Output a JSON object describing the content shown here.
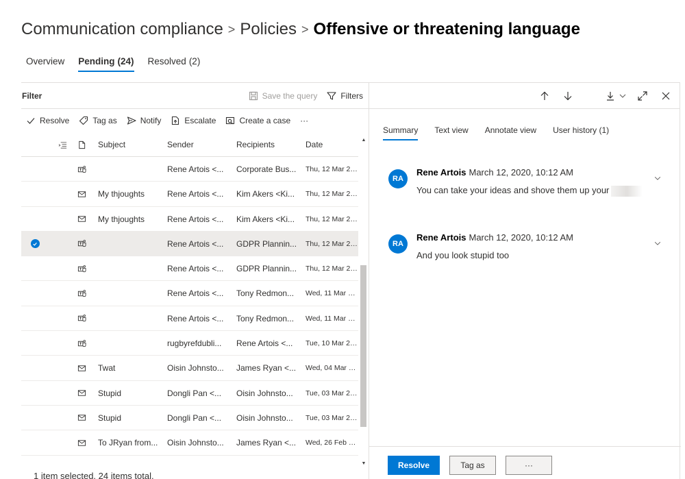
{
  "breadcrumb": {
    "items": [
      "Communication compliance",
      "Policies"
    ],
    "separator": ">",
    "current": "Offensive or threatening language"
  },
  "tabs": [
    {
      "label": "Overview",
      "count": ""
    },
    {
      "label": "Pending",
      "count": "(24)"
    },
    {
      "label": "Resolved",
      "count": "(2)"
    }
  ],
  "filter": {
    "title": "Filter",
    "save_query": "Save the query",
    "filters": "Filters"
  },
  "commands": {
    "resolve": "Resolve",
    "tag_as": "Tag as",
    "notify": "Notify",
    "escalate": "Escalate",
    "create_case": "Create a case",
    "more": "···"
  },
  "columns": {
    "subject": "Subject",
    "sender": "Sender",
    "recipients": "Recipients",
    "date": "Date"
  },
  "rows": [
    {
      "type": "teams",
      "subject": "",
      "sender": "Rene Artois <...",
      "recipients": "Corporate Bus...",
      "date": "Thu, 12 Mar 202...",
      "selected": false
    },
    {
      "type": "mail",
      "subject": "My thjoughts",
      "sender": "Rene Artois <...",
      "recipients": "Kim Akers <Ki...",
      "date": "Thu, 12 Mar 202...",
      "selected": false
    },
    {
      "type": "mail",
      "subject": "My thjoughts",
      "sender": "Rene Artois <...",
      "recipients": "Kim Akers <Ki...",
      "date": "Thu, 12 Mar 202...",
      "selected": false
    },
    {
      "type": "teams",
      "subject": "",
      "sender": "Rene Artois <...",
      "recipients": "GDPR Plannin...",
      "date": "Thu, 12 Mar 202...",
      "selected": true
    },
    {
      "type": "teams",
      "subject": "",
      "sender": "Rene Artois <...",
      "recipients": "GDPR Plannin...",
      "date": "Thu, 12 Mar 202...",
      "selected": false
    },
    {
      "type": "teams",
      "subject": "",
      "sender": "Rene Artois <...",
      "recipients": "Tony Redmon...",
      "date": "Wed, 11 Mar 202",
      "selected": false
    },
    {
      "type": "teams",
      "subject": "",
      "sender": "Rene Artois <...",
      "recipients": "Tony Redmon...",
      "date": "Wed, 11 Mar 202",
      "selected": false
    },
    {
      "type": "teams",
      "subject": "",
      "sender": "rugbyrefdubli...",
      "recipients": "Rene Artois <...",
      "date": "Tue, 10 Mar 202...",
      "selected": false
    },
    {
      "type": "mail",
      "subject": "Twat",
      "sender": "Oisin Johnsto...",
      "recipients": "James Ryan <...",
      "date": "Wed, 04 Mar 202",
      "selected": false
    },
    {
      "type": "mail",
      "subject": "Stupid",
      "sender": "Dongli Pan <...",
      "recipients": "Oisin Johnsto...",
      "date": "Tue, 03 Mar 202...",
      "selected": false
    },
    {
      "type": "mail",
      "subject": "Stupid",
      "sender": "Dongli Pan <...",
      "recipients": "Oisin Johnsto...",
      "date": "Tue, 03 Mar 202...",
      "selected": false
    },
    {
      "type": "mail",
      "subject": "To JRyan from...",
      "sender": "Oisin Johnsto...",
      "recipients": "James Ryan <...",
      "date": "Wed, 26 Feb 202...",
      "selected": false
    },
    {
      "type": "mail",
      "subject": "",
      "sender": "",
      "recipients": "",
      "date": "",
      "selected": false
    }
  ],
  "status": "1 item selected.  24 items total.",
  "detail": {
    "tabs": [
      "Summary",
      "Text view",
      "Annotate view",
      "User history (1)"
    ],
    "messages": [
      {
        "initials": "RA",
        "author": "Rene Artois",
        "time": "March 12, 2020, 10:12 AM",
        "body": "You can take your ideas and shove them up your"
      },
      {
        "initials": "RA",
        "author": "Rene Artois",
        "time": "March 12, 2020, 10:12 AM",
        "body": "And you look stupid too"
      }
    ],
    "buttons": {
      "resolve": "Resolve",
      "tag_as": "Tag as",
      "more": "···"
    }
  },
  "colors": {
    "accent": "#0078d4",
    "selected_row": "#edebe9",
    "border": "#e1dfdd"
  }
}
